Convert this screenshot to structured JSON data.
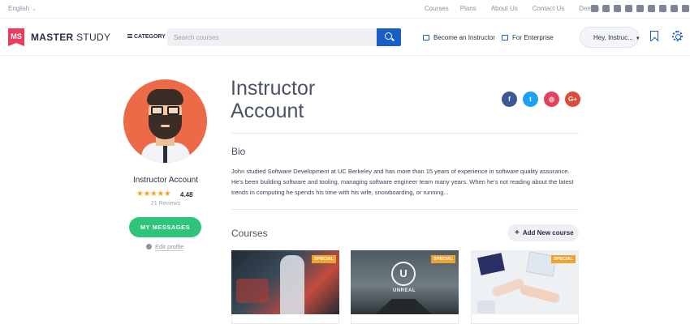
{
  "topbar": {
    "language": "English",
    "links": [
      "Courses",
      "Plans",
      "About Us",
      "Contact Us",
      "Demos"
    ],
    "social_icons": [
      "twitter-icon",
      "instagram-icon",
      "behance-icon",
      "dribbble-icon",
      "flickr-icon",
      "git-icon",
      "google-icon",
      "linkedin-icon",
      "facebook-icon"
    ]
  },
  "header": {
    "logo_mark": "MS",
    "logo_bold": "MASTER",
    "logo_light": "STUDY",
    "category_label": "CATEGORY",
    "search_placeholder": "Search courses",
    "become_instructor": "Become an Instructor",
    "for_enterprise": "For Enterprise",
    "user_menu": "Hey, Instruc...",
    "accent_color": "#195ec8"
  },
  "profile": {
    "name": "Instructor Account",
    "rating_stars": "★★★★★",
    "rating_value": "4.48",
    "reviews": "21 Reviews",
    "messages_button": "MY MESSAGES",
    "edit_profile": "Edit profile",
    "button_color": "#2ec57b"
  },
  "main": {
    "title": "Instructor Account",
    "share": [
      {
        "label": "f",
        "icon": "facebook-icon",
        "color": "#3b5998"
      },
      {
        "label": "t",
        "icon": "twitter-icon",
        "color": "#1da1f2"
      },
      {
        "label": "◎",
        "icon": "instagram-icon",
        "color": "#e4405f"
      },
      {
        "label": "G+",
        "icon": "google-plus-icon",
        "color": "#dd4b39"
      }
    ],
    "bio_heading": "Bio",
    "bio_text": "John studied Software Development at UC Berkeley and has more than 15 years of experience in software quality assurance. He's been building software and tooling, managing software engineer team many years. When he's not reading about the latest trends in computing he spends his time with his wife, snowboarding, or running...",
    "courses_heading": "Courses",
    "add_course": "Add New course",
    "courses": [
      {
        "badge": "SPECIAL"
      },
      {
        "badge": "SPECIAL",
        "logo_text": "UNREAL"
      },
      {
        "badge": "SPECIAL"
      }
    ]
  }
}
